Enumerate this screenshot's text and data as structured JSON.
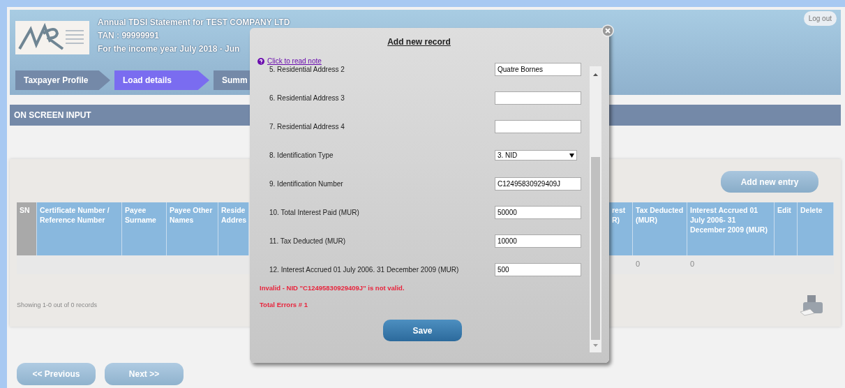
{
  "header": {
    "title_lines": [
      "Annual TDSI Statement for TEST COMPANY LTD",
      "TAN : 99999991",
      "For the income year July 2018 - Jun"
    ],
    "logout": "Log out",
    "steps": [
      {
        "label": "Taxpayer Profile",
        "selected": false
      },
      {
        "label": "Load details",
        "selected": true
      },
      {
        "label": "Summ",
        "selected": false
      }
    ]
  },
  "section_title": "ON SCREEN INPUT",
  "add_button": "Add new entry",
  "table": {
    "left_columns": [
      {
        "label": "SN"
      },
      {
        "label": "Certificate Number / Reference Number"
      },
      {
        "label": "Payee Surname"
      },
      {
        "label": "Payee Other Names"
      },
      {
        "label": "Reside Addres"
      }
    ],
    "right_columns": [
      {
        "label": "rest R)"
      },
      {
        "label": "Tax Deducted (MUR)",
        "cells": [
          "0"
        ]
      },
      {
        "label": "Interest Accrued 01 July 2006- 31 December 2009 (MUR)",
        "cells": [
          "0"
        ]
      },
      {
        "label": "Edit"
      },
      {
        "label": "Delete"
      }
    ]
  },
  "records_info": "Showing 1-0 out of 0 records",
  "nav": [
    "<< Previous",
    "Next >>"
  ],
  "modal": {
    "title": "Add new record",
    "note_link": "Click to read note",
    "fields": [
      {
        "kind": "text",
        "label": "5. Residential Address 2",
        "value": "Quatre Bornes"
      },
      {
        "kind": "text",
        "label": "6. Residential Address 3"
      },
      {
        "kind": "text",
        "label": "7. Residential Address 4"
      },
      {
        "kind": "select",
        "label": "8. Identification Type",
        "value": "3. NID"
      },
      {
        "kind": "text",
        "label": "9. Identification Number",
        "value": "C12495830929409J"
      },
      {
        "kind": "text",
        "label": "10. Total Interest Paid (MUR)",
        "value": "50000"
      },
      {
        "kind": "text",
        "label": "11. Tax Deducted (MUR)",
        "value": "10000"
      },
      {
        "kind": "text",
        "label": "12. Interest Accrued 01 July 2006. 31 December 2009 (MUR)",
        "value": "500"
      }
    ],
    "errors": [
      "Invalid - NID \"C12495830929409J\" is not valid.",
      "Total Errors # 1"
    ],
    "save": "Save"
  }
}
